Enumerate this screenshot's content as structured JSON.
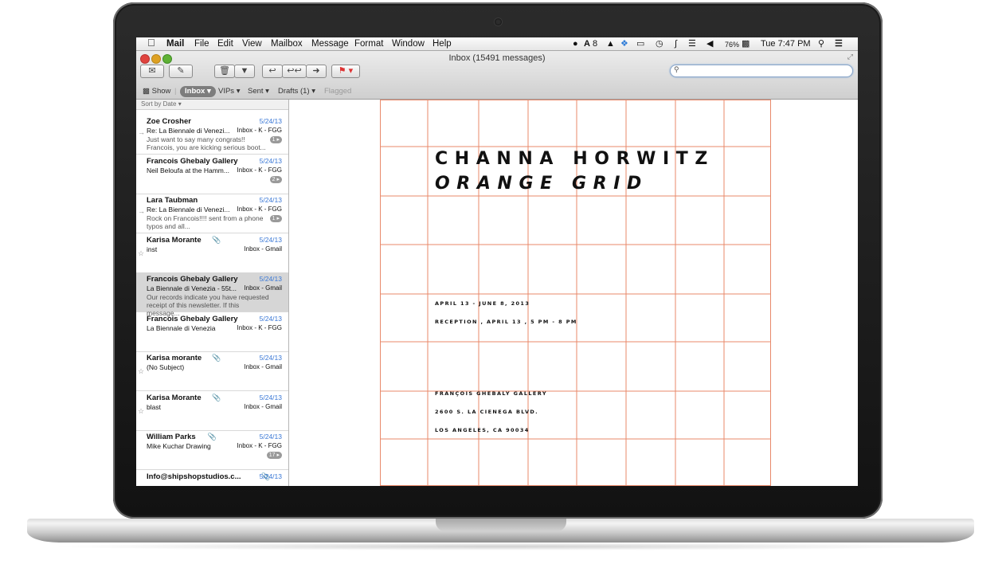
{
  "menubar": {
    "apple_icon": "",
    "items": [
      "Mail",
      "File",
      "Edit",
      "View",
      "Mailbox",
      "Message",
      "Format",
      "Window",
      "Help"
    ],
    "status_icons": [
      "bubble-icon",
      "adobe-icon",
      "drive-icon",
      "dropbox-icon",
      "airplay-icon",
      "time-machine-icon",
      "bluetooth-icon",
      "wifi-icon",
      "volume-icon"
    ],
    "adobe_count": "8",
    "battery": "76%",
    "clock": "Tue 7:47 PM"
  },
  "window": {
    "title": "Inbox (15491 messages)",
    "search_placeholder": ""
  },
  "favorites": {
    "show": "Show",
    "inbox": "Inbox ▾",
    "vips": "VIPs ▾",
    "sent": "Sent ▾",
    "drafts": "Drafts (1) ▾",
    "flagged": "Flagged"
  },
  "list": {
    "sort": "Sort by Date ▾",
    "messages": [
      {
        "sender": "Zoe Crosher",
        "date": "5/24/13",
        "subject": "Re: La Biennale di Venezi...",
        "mailbox": "Inbox - K - FGG",
        "preview": "Just want to say many congrats!! Francois, you are kicking serious boot...",
        "badge": "1",
        "attachment": false,
        "selected": false
      },
      {
        "sender": "Francois Ghebaly Gallery",
        "date": "5/24/13",
        "subject": "Neil Beloufa at the Hamm...",
        "mailbox": "Inbox - K - FGG",
        "preview": "",
        "badge": "2",
        "attachment": false,
        "selected": false
      },
      {
        "sender": "Lara Taubman",
        "date": "5/24/13",
        "subject": "Re: La Biennale di Venezi...",
        "mailbox": "Inbox - K - FGG",
        "preview": "Rock on Francois!!!! sent from a phone typos and all...",
        "badge": "1",
        "attachment": false,
        "selected": false
      },
      {
        "sender": "Karisa Morante",
        "date": "5/24/13",
        "subject": "inst",
        "mailbox": "Inbox - Gmail",
        "preview": "",
        "badge": "",
        "attachment": true,
        "selected": false
      },
      {
        "sender": "Francois Ghebaly Gallery",
        "date": "5/24/13",
        "subject": "La Biennale di Venezia - 55t...",
        "mailbox": "Inbox - Gmail",
        "preview": "Our records indicate you have requested receipt of this newsletter. If this message...",
        "badge": "",
        "attachment": false,
        "selected": true
      },
      {
        "sender": "Francois Ghebaly Gallery",
        "date": "5/24/13",
        "subject": "La Biennale di Venezia",
        "mailbox": "Inbox - K - FGG",
        "preview": "",
        "badge": "",
        "attachment": false,
        "selected": false
      },
      {
        "sender": "Karisa morante",
        "date": "5/24/13",
        "subject": "(No Subject)",
        "mailbox": "Inbox - Gmail",
        "preview": "",
        "badge": "",
        "attachment": true,
        "selected": false
      },
      {
        "sender": "Karisa Morante",
        "date": "5/24/13",
        "subject": "blast",
        "mailbox": "Inbox - Gmail",
        "preview": "",
        "badge": "",
        "attachment": true,
        "selected": false
      },
      {
        "sender": "William Parks",
        "date": "5/24/13",
        "subject": "Mike Kuchar Drawing",
        "mailbox": "Inbox - K - FGG",
        "preview": "",
        "badge": "17",
        "attachment": true,
        "selected": false
      },
      {
        "sender": "Info@shipshopstudios.c...",
        "date": "5/24/13",
        "subject": "",
        "mailbox": "",
        "preview": "",
        "badge": "",
        "attachment": true,
        "selected": false
      }
    ]
  },
  "email": {
    "artist": "CHANNA HORWITZ",
    "show_title": "ORANGE GRID",
    "dates": "APRIL 13 - JUNE 8, 2013",
    "reception": "RECEPTION , APRIL 13 , 5 PM - 8 PM",
    "gallery": "FRANÇOIS GHEBALY GALLERY",
    "address1": "2600 S. LA CIENEGA BLVD.",
    "address2": "LOS ANGELES, CA 90034",
    "grid_color": "#e8896a"
  }
}
